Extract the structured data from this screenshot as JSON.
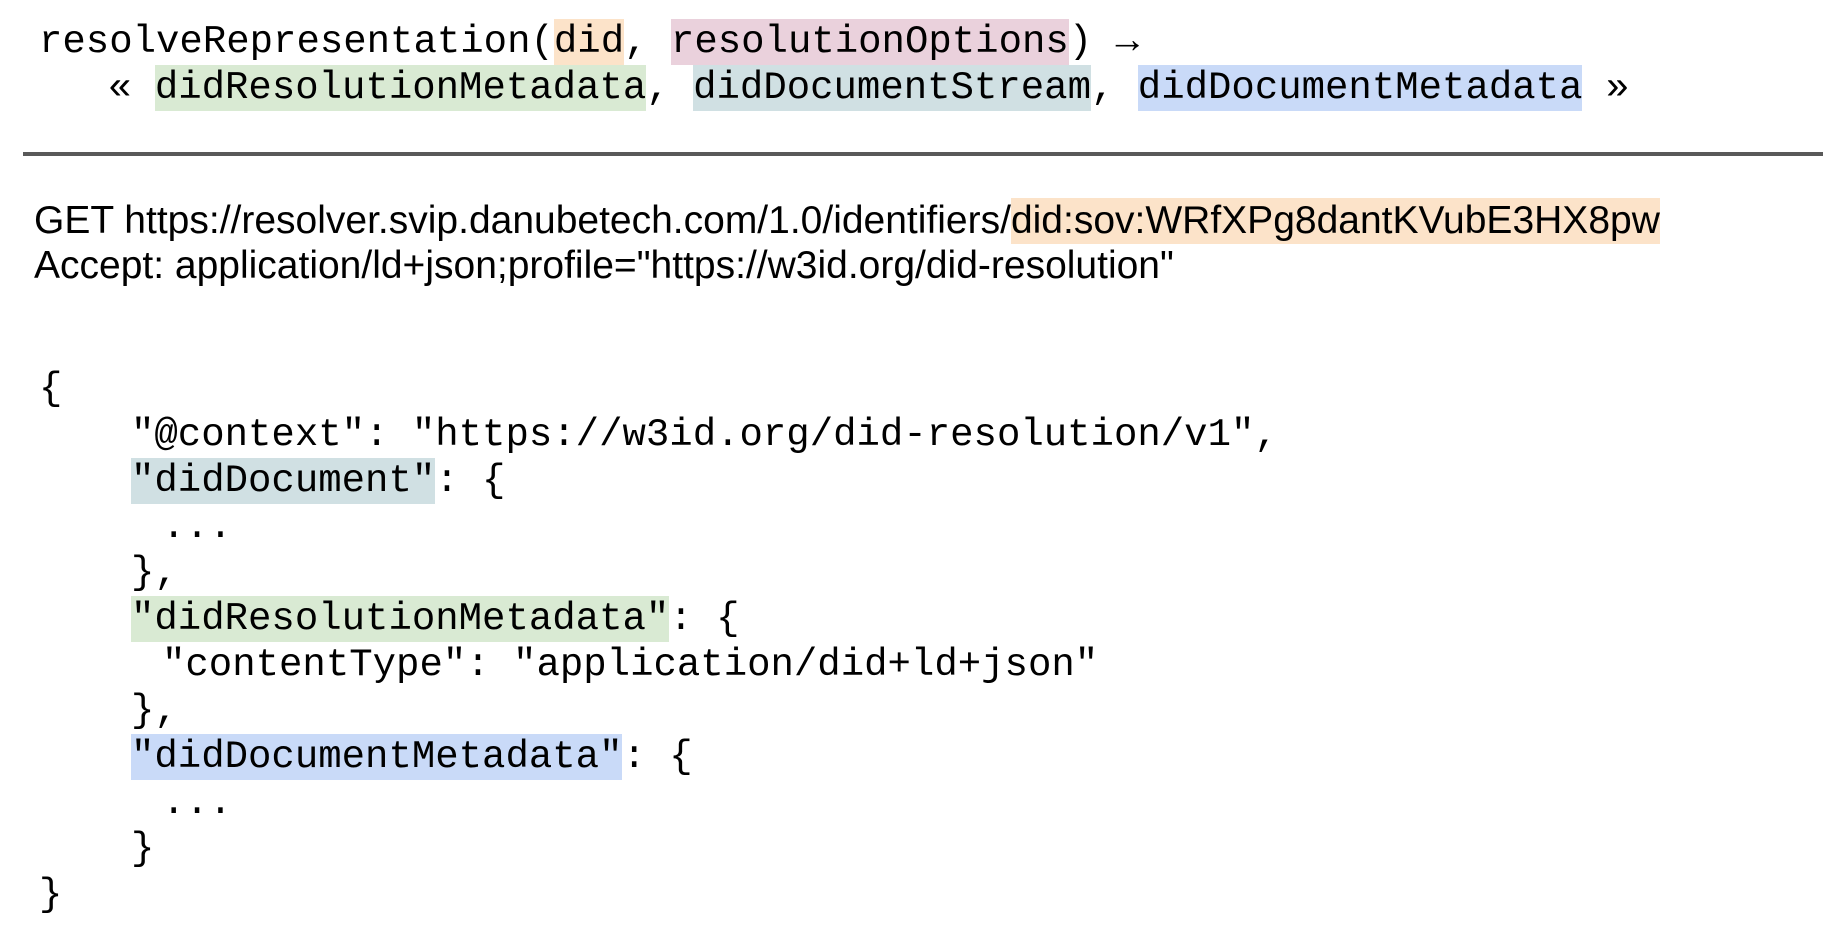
{
  "signature": {
    "fn_name": "resolveRepresentation(",
    "param_did": "did",
    "sep1": ", ",
    "param_options": "resolutionOptions",
    "close_arrow": ") →",
    "open_guillemet": "« ",
    "out_metadata": "didResolutionMetadata",
    "sep2": ", ",
    "out_stream": "didDocumentStream",
    "sep3": ", ",
    "out_doc_metadata": "didDocumentMetadata",
    "close_guillemet": " »"
  },
  "request": {
    "method_url_prefix": "GET https://resolver.svip.danubetech.com/1.0/identifiers/",
    "did": "did:sov:WRfXPg8dantKVubE3HX8pw",
    "accept_header": "Accept: application/ld+json;profile=\"https://w3id.org/did-resolution\""
  },
  "response": {
    "open_brace": "{",
    "context_line": "\"@context\": \"https://w3id.org/did-resolution/v1\",",
    "did_document_key": "\"didDocument\"",
    "did_document_open": ": {",
    "did_document_body": "...",
    "did_document_close": "},",
    "resolution_metadata_key": "\"didResolutionMetadata\"",
    "resolution_metadata_open": ": {",
    "content_type_line": "\"contentType\": \"application/did+ld+json\"",
    "resolution_metadata_close": "},",
    "document_metadata_key": "\"didDocumentMetadata\"",
    "document_metadata_open": ": {",
    "document_metadata_body": "...",
    "document_metadata_close": "}",
    "close_brace": "}"
  },
  "colors": {
    "did": "#fce3c9",
    "resolution_options": "#ead1dc",
    "did_resolution_metadata": "#d9ead3",
    "did_document_stream": "#d0e0e3",
    "did_document_metadata": "#c9daf8",
    "divider": "#595959"
  }
}
